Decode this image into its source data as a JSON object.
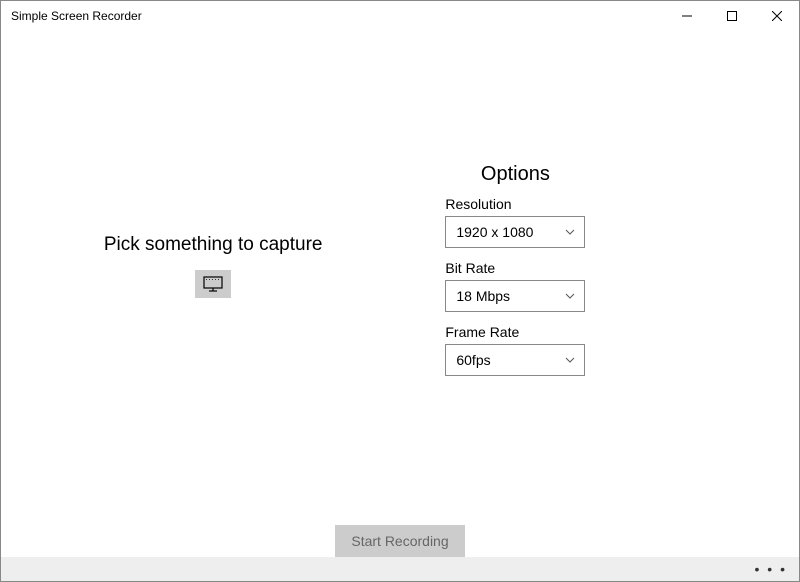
{
  "window": {
    "title": "Simple Screen Recorder"
  },
  "capture": {
    "prompt": "Pick something to capture"
  },
  "options": {
    "heading": "Options",
    "resolution": {
      "label": "Resolution",
      "value": "1920 x 1080"
    },
    "bitrate": {
      "label": "Bit Rate",
      "value": "18 Mbps"
    },
    "framerate": {
      "label": "Frame Rate",
      "value": "60fps"
    }
  },
  "actions": {
    "start": "Start Recording"
  },
  "status": {
    "more": "• • •"
  }
}
